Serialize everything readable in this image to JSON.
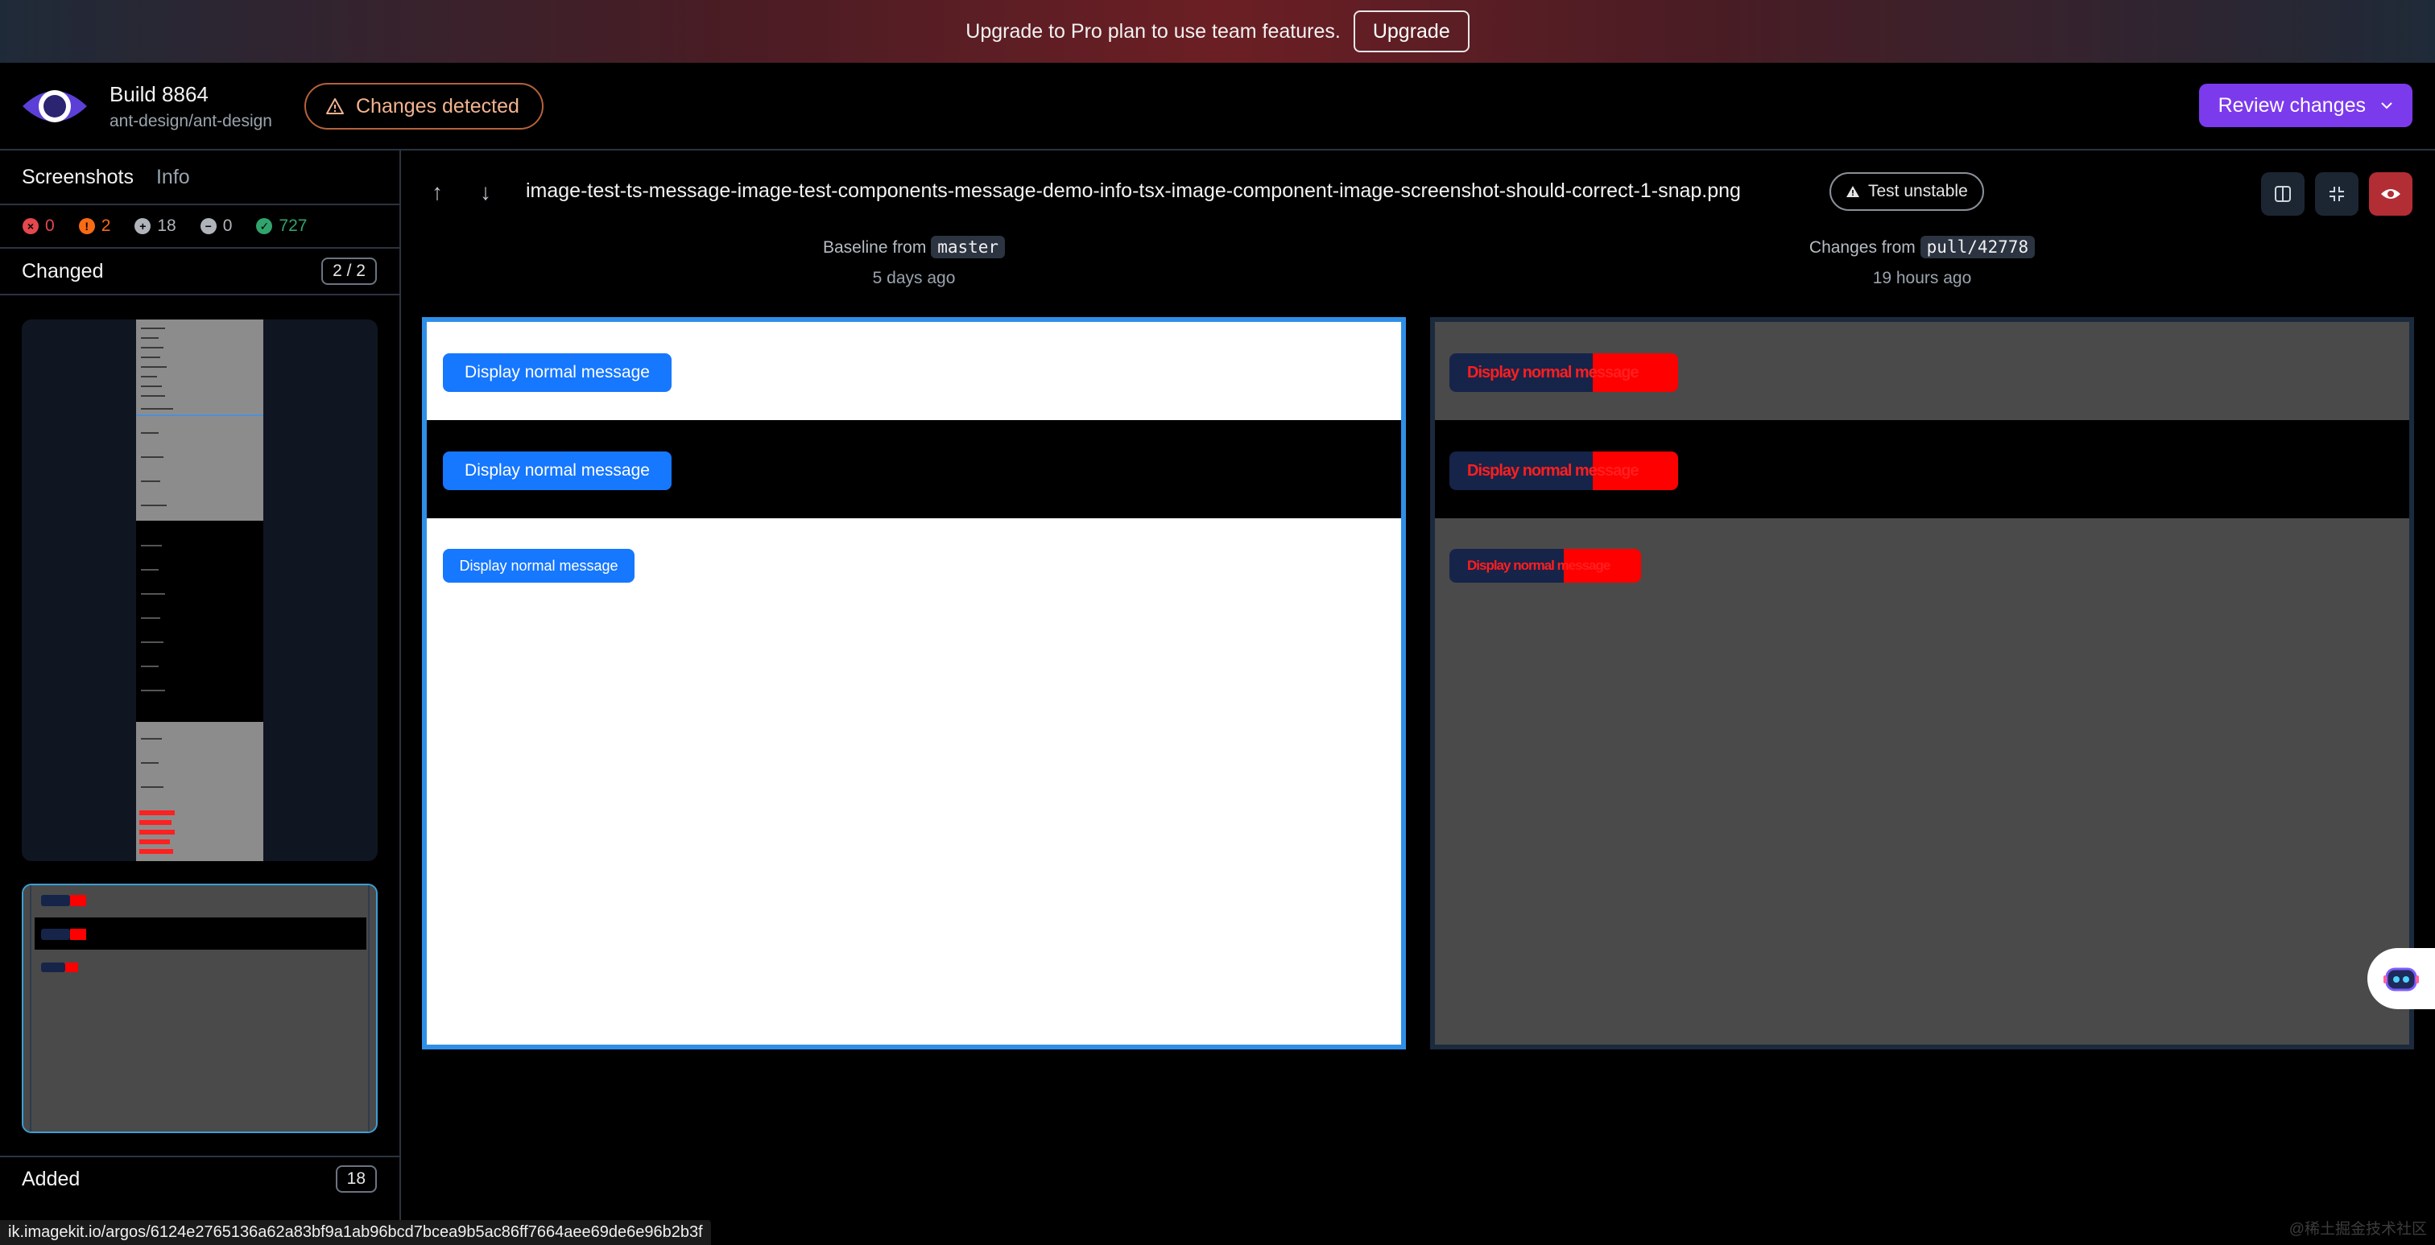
{
  "banner": {
    "text": "Upgrade to Pro plan to use team features.",
    "button": "Upgrade"
  },
  "header": {
    "build_title": "Build 8864",
    "repo": "ant-design/ant-design",
    "status_badge": "Changes detected",
    "review_button": "Review changes"
  },
  "sidebar": {
    "tabs": [
      "Screenshots",
      "Info"
    ],
    "stats": [
      {
        "icon": "failure-icon",
        "value": "0",
        "color": "#e5484d"
      },
      {
        "icon": "changed-icon",
        "value": "2",
        "color": "#f76b15"
      },
      {
        "icon": "added-icon",
        "value": "18",
        "color": "#b0b4ba"
      },
      {
        "icon": "removed-icon",
        "value": "0",
        "color": "#b0b4ba"
      },
      {
        "icon": "unchanged-icon",
        "value": "727",
        "color": "#30a46c"
      }
    ],
    "changed_group": {
      "title": "Changed",
      "count": "2 / 2"
    },
    "added_group": {
      "title": "Added",
      "count": "18"
    },
    "status_url": "ik.imagekit.io/argos/6124e2765136a62a83bf9a1ab96bcd7bcea9b5ac86ff7664aee69de6e96b2b3f"
  },
  "main": {
    "filename": "image-test-ts-message-image-test-components-message-demo-info-tsx-image-component-image-screenshot-should-correct-1-snap.png",
    "unstable_label": "Test unstable",
    "baseline": {
      "prefix": "Baseline from",
      "branch": "master",
      "ago": "5 days ago"
    },
    "changes": {
      "prefix": "Changes from",
      "branch": "pull/42778",
      "ago": "19 hours ago"
    },
    "baseline_buttons": [
      "Display normal message",
      "Display normal message",
      "Display normal message"
    ],
    "diff_buttons": [
      "Display normal message",
      "Display normal message",
      "Display normal message"
    ]
  },
  "watermark": "@稀土掘金技术社区",
  "colors": {
    "accent": "#7c3aed",
    "baseline_border": "#2f8fe8",
    "diff_red": "#ff0000",
    "antd_blue": "#1677ff"
  }
}
